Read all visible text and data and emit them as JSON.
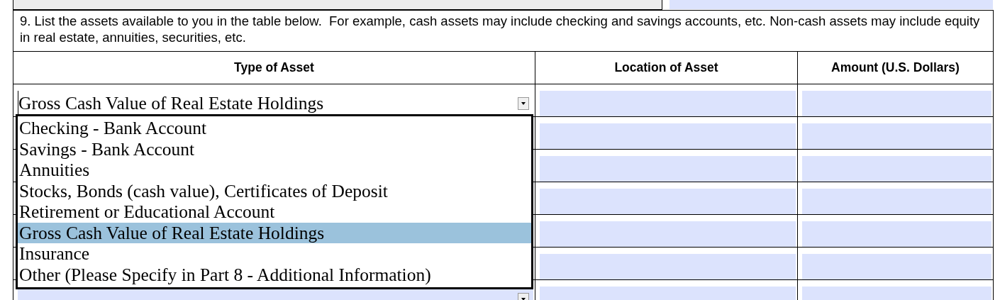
{
  "instructions": "9. List the assets available to you in the table below.  For example, cash assets may include checking and savings accounts, etc. Non-cash assets may include equity in real estate, annuities, securities, etc.",
  "table": {
    "columns": [
      "Type of Asset",
      "Location of Asset",
      "Amount (U.S. Dollars)"
    ],
    "rows": [
      {
        "kind": "entry",
        "type_of_asset": "Gross Cash Value of Real Estate Holdings",
        "focused": true
      },
      {
        "kind": "entry"
      },
      {
        "kind": "entry"
      },
      {
        "kind": "entry"
      },
      {
        "kind": "entry"
      },
      {
        "kind": "entry"
      },
      {
        "kind": "entry",
        "focused": false
      }
    ]
  },
  "dropdown": {
    "expanded": true,
    "options": [
      {
        "label": "Checking - Bank Account",
        "selected": false
      },
      {
        "label": "Savings - Bank Account",
        "selected": false
      },
      {
        "label": "Annuities",
        "selected": false
      },
      {
        "label": "Stocks, Bonds (cash value), Certificates of Deposit",
        "selected": false
      },
      {
        "label": "Retirement or Educational Account",
        "selected": false
      },
      {
        "label": "Gross Cash Value of Real Estate Holdings",
        "selected": true
      },
      {
        "label": "Insurance",
        "selected": false
      },
      {
        "label": "Other (Please Specify in Part 8 - Additional Information)",
        "selected": false
      }
    ]
  }
}
